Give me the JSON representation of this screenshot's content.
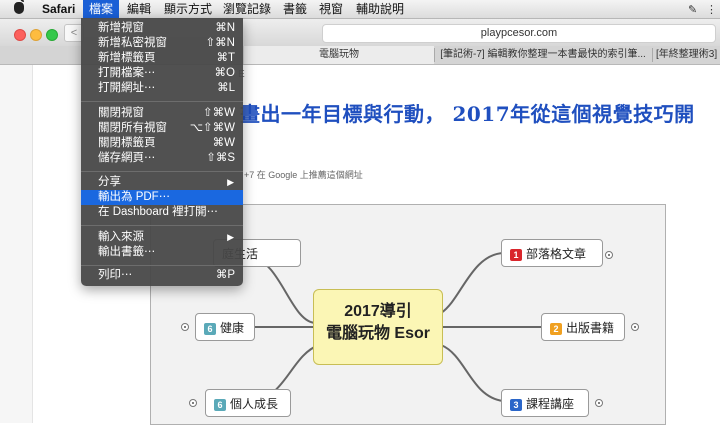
{
  "menubar": {
    "app_name": "Safari",
    "items": [
      "檔案",
      "編輯",
      "顯示方式",
      "瀏覽記錄",
      "書籤",
      "視窗",
      "輔助說明"
    ]
  },
  "toolbar": {
    "url": "playpcesor.com",
    "back_glyph": "<"
  },
  "tabs": [
    {
      "label": "電腦玩物",
      "active": true
    },
    {
      "label": "[筆記術-7] 編輯教你整理一本書最快的索引筆...",
      "active": false
    },
    {
      "label": "[年終整理術3] E",
      "active": false
    }
  ],
  "page": {
    "breadcrumb": "E",
    "heading_line1": "畫出一年目標與行動， 2017年從這個視覺技巧開",
    "heading_line2": "",
    "social_text": "+7   在 Google 上推薦這個網址"
  },
  "mindmap": {
    "center_line1": "2017導引",
    "center_line2": "電腦玩物 Esor",
    "center_color": "#fbf6b5",
    "nodes": [
      {
        "label": "庭生活",
        "badge": "",
        "badge_color": ""
      },
      {
        "label": "健康",
        "badge": "6",
        "badge_color": "#5aa9b8"
      },
      {
        "label": "個人成長",
        "badge": "6",
        "badge_color": "#5aa9b8"
      },
      {
        "label": "部落格文章",
        "badge": "1",
        "badge_color": "#d9262c"
      },
      {
        "label": "出版書籍",
        "badge": "2",
        "badge_color": "#f0a020"
      },
      {
        "label": "課程講座",
        "badge": "3",
        "badge_color": "#2a66c9"
      }
    ]
  },
  "file_menu": {
    "items": [
      {
        "label": "新增視窗",
        "shortcut": "⌘N"
      },
      {
        "label": "新增私密視窗",
        "shortcut": "⇧⌘N"
      },
      {
        "label": "新增標籤頁",
        "shortcut": "⌘T"
      },
      {
        "label": "打開檔案⋯",
        "shortcut": "⌘O"
      },
      {
        "label": "打開網址⋯",
        "shortcut": "⌘L"
      },
      {
        "label": "關閉視窗",
        "shortcut": "⇧⌘W"
      },
      {
        "label": "關閉所有視窗",
        "shortcut": "⌥⇧⌘W"
      },
      {
        "label": "關閉標籤頁",
        "shortcut": "⌘W"
      },
      {
        "label": "儲存網頁⋯",
        "shortcut": "⇧⌘S"
      },
      {
        "label": "分享",
        "shortcut": "",
        "submenu": true
      },
      {
        "label": "輸出為 PDF⋯",
        "shortcut": "",
        "highlighted": true
      },
      {
        "label": "在 Dashboard 裡打開⋯",
        "shortcut": ""
      },
      {
        "label": "輸入來源",
        "shortcut": "",
        "submenu": true
      },
      {
        "label": "輸出書籤⋯",
        "shortcut": ""
      },
      {
        "label": "列印⋯",
        "shortcut": "⌘P"
      }
    ]
  }
}
